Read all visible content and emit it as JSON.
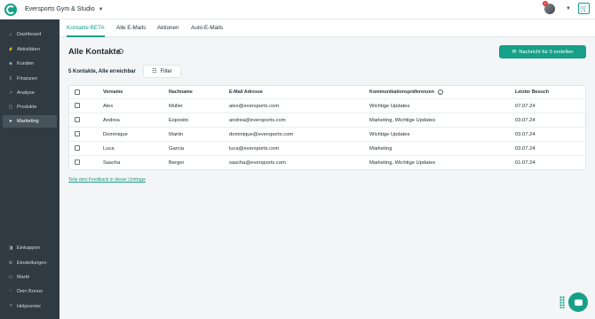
{
  "header": {
    "studio_name": "Eversports Gym & Studio",
    "notification_count": "1"
  },
  "sidebar": {
    "items": [
      {
        "label": "Dashboard",
        "icon": "house-icon"
      },
      {
        "label": "Aktivitäten",
        "icon": "bolt-icon"
      },
      {
        "label": "Kunden",
        "icon": "person-icon"
      },
      {
        "label": "Finanzen",
        "icon": "euro-icon"
      },
      {
        "label": "Analyse",
        "icon": "chart-icon"
      },
      {
        "label": "Produkte",
        "icon": "box-icon"
      },
      {
        "label": "Marketing",
        "icon": "megaphone-icon"
      }
    ],
    "bottom_items": [
      {
        "label": "Einkappen",
        "icon": "collapse-icon"
      },
      {
        "label": "Einstellungen",
        "icon": "gear-icon"
      },
      {
        "label": "Markt",
        "icon": "store-icon"
      },
      {
        "label": "Dein Bonus",
        "icon": "heart-icon"
      },
      {
        "label": "Helpcenter",
        "icon": "help-icon"
      }
    ]
  },
  "tabs": [
    {
      "label": "Kontakte BETA"
    },
    {
      "label": "Alle E-Mails"
    },
    {
      "label": "Aktionen"
    },
    {
      "label": "Auto-E-Mails"
    }
  ],
  "main": {
    "title": "Alle Kontakte",
    "cta_label": "Nachricht für 5 erstellen",
    "count_text": "5 Kontakte, Alle erreichbar",
    "filter_label": "Filter",
    "feedback_link": "Teile dein Feedback in dieser Umfrage"
  },
  "table": {
    "columns": [
      "Vorname",
      "Nachname",
      "E-Mail Adresse",
      "Kommunikationspräferenzen",
      "Letzter Besuch"
    ],
    "rows": [
      [
        "Alex",
        "Müller",
        "alex@eversports.com",
        "Wichtige Updates",
        "07.07.24"
      ],
      [
        "Andrea",
        "Esposito",
        "andrea@eversports.com",
        "Marketing, Wichtige Updates",
        "03.07.24"
      ],
      [
        "Dominique",
        "Martin",
        "dominique@eversports.com",
        "Wichtige Updates",
        "03.07.24"
      ],
      [
        "Luca",
        "Garcia",
        "luca@eversports.com",
        "Marketing",
        "03.07.24"
      ],
      [
        "Sascha",
        "Berger",
        "sascha@eversports.com",
        "Marketing, Wichtige Updates",
        "01.07.24"
      ]
    ]
  },
  "colors": {
    "accent": "#16a089",
    "sidebar": "#2f3a43"
  }
}
